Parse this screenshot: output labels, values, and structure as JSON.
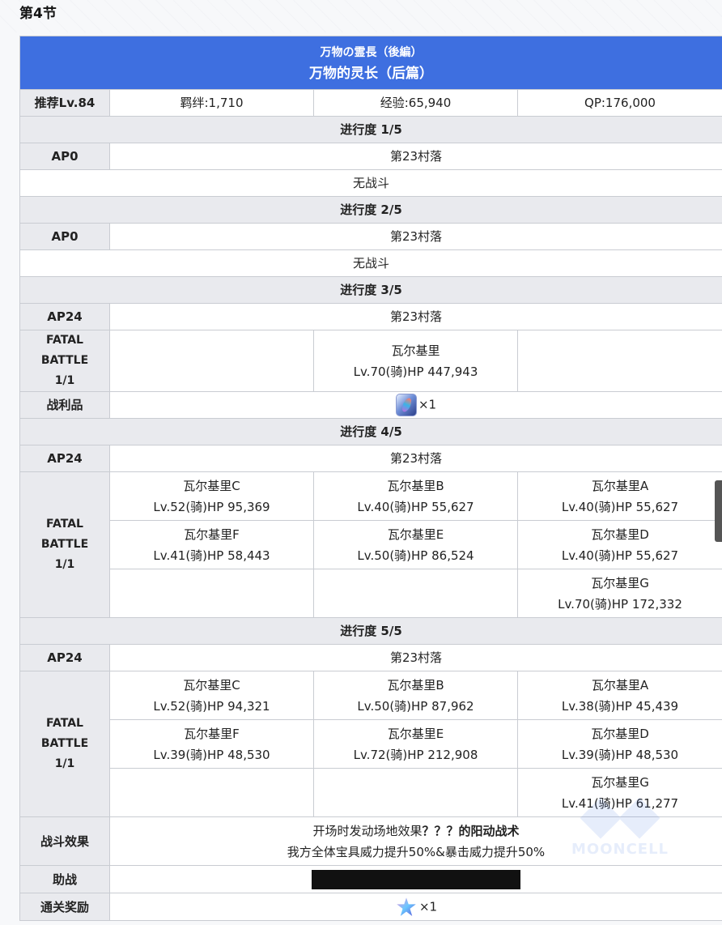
{
  "section_title": "第4节",
  "quest": {
    "title_jp": "万物の霊長（後編）",
    "title_cn": "万物的灵长（后篇）",
    "recommend_level": "推荐Lv.84",
    "bond": "羁绊:1,710",
    "exp": "经验:65,940",
    "qp": "QP:176,000"
  },
  "labels": {
    "fatal_battle": "FATAL BATTLE",
    "wave": "1/1",
    "drops": "战利品",
    "battle_effect": "战斗效果",
    "support": "助战",
    "clear_reward": "通关奖励",
    "no_battle": "无战斗"
  },
  "progress": [
    {
      "label": "进行度 1/5",
      "ap": "AP0",
      "location": "第23村落"
    },
    {
      "label": "进行度 2/5",
      "ap": "AP0",
      "location": "第23村落"
    },
    {
      "label": "进行度 3/5",
      "ap": "AP24",
      "location": "第23村落"
    },
    {
      "label": "进行度 4/5",
      "ap": "AP24",
      "location": "第23村落"
    },
    {
      "label": "进行度 5/5",
      "ap": "AP24",
      "location": "第23村落"
    }
  ],
  "p3_enemy": {
    "name": "瓦尔基里",
    "stats": "Lv.70(骑)HP 447,943"
  },
  "p3_drop": {
    "icon": "prism-gem-icon",
    "count": "×1"
  },
  "p4_enemies": [
    {
      "name": "瓦尔基里C",
      "stats": "Lv.52(骑)HP 95,369"
    },
    {
      "name": "瓦尔基里B",
      "stats": "Lv.40(骑)HP 55,627"
    },
    {
      "name": "瓦尔基里A",
      "stats": "Lv.40(骑)HP 55,627"
    },
    {
      "name": "瓦尔基里F",
      "stats": "Lv.41(骑)HP 58,443"
    },
    {
      "name": "瓦尔基里E",
      "stats": "Lv.50(骑)HP 86,524"
    },
    {
      "name": "瓦尔基里D",
      "stats": "Lv.40(骑)HP 55,627"
    },
    {
      "name": "瓦尔基里G",
      "stats": "Lv.70(骑)HP 172,332"
    }
  ],
  "p5_enemies": [
    {
      "name": "瓦尔基里C",
      "stats": "Lv.52(骑)HP 94,321"
    },
    {
      "name": "瓦尔基里B",
      "stats": "Lv.50(骑)HP 87,962"
    },
    {
      "name": "瓦尔基里A",
      "stats": "Lv.38(骑)HP 45,439"
    },
    {
      "name": "瓦尔基里F",
      "stats": "Lv.39(骑)HP 48,530"
    },
    {
      "name": "瓦尔基里E",
      "stats": "Lv.72(骑)HP 212,908"
    },
    {
      "name": "瓦尔基里D",
      "stats": "Lv.39(骑)HP 48,530"
    },
    {
      "name": "瓦尔基里G",
      "stats": "Lv.41(骑)HP 61,277"
    }
  ],
  "battle_effect": {
    "line1_prefix": "开场时发动场地效果",
    "line1_bold": "？？？的阳动战术",
    "line2": "我方全体宝具威力提升50%&暴击威力提升50%"
  },
  "clear_reward": {
    "icon": "saint-quartz-icon",
    "count": "×1"
  },
  "watermark": "MOONCELL",
  "colors": {
    "banner": "#3e6fe0",
    "label_bg": "#e9eaee",
    "border": "#c9ccd2"
  }
}
